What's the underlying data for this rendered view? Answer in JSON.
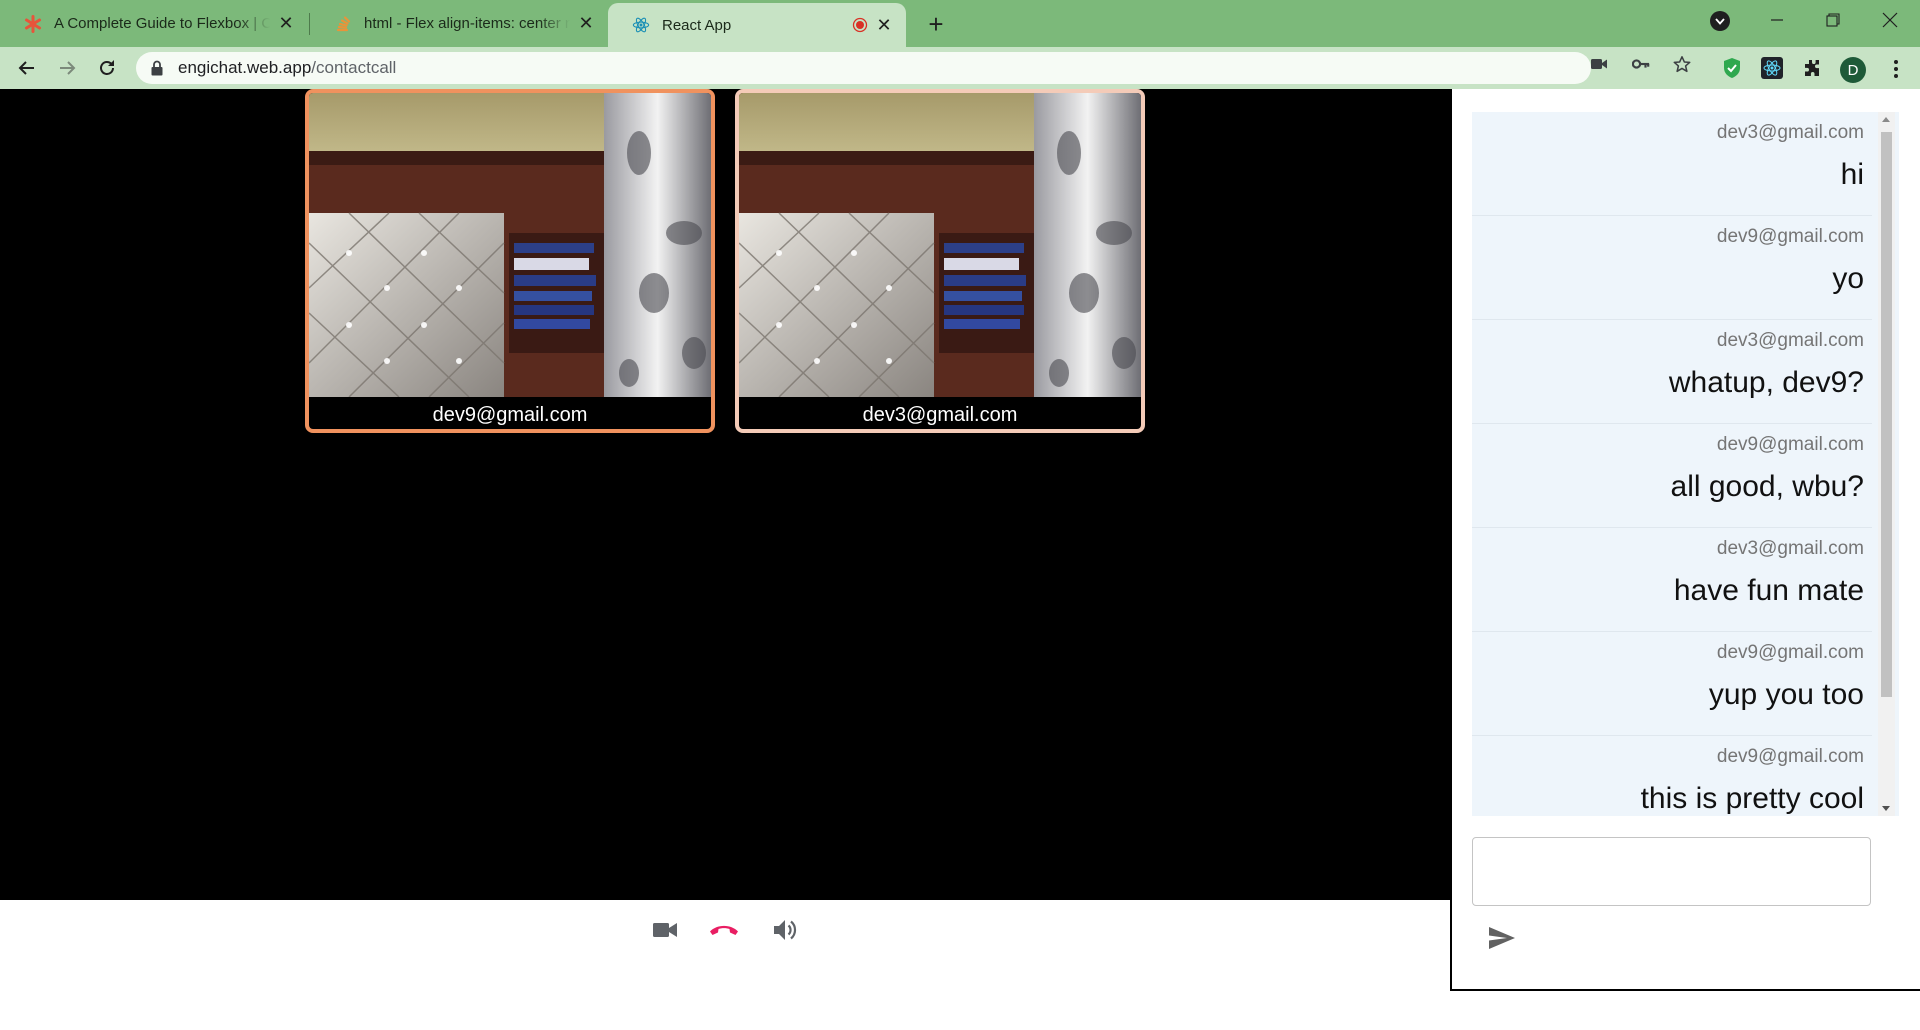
{
  "browser": {
    "tabs": [
      {
        "title": "A Complete Guide to Flexbox | CSS-Tricks",
        "favicon": "asterisk-icon",
        "active": false
      },
      {
        "title": "html - Flex align-items: center not working",
        "favicon": "stackoverflow-icon",
        "active": false
      },
      {
        "title": "React App",
        "favicon": "react-icon",
        "active": true,
        "recording": true
      }
    ],
    "url_host": "engichat.web.app",
    "url_path": "/contactcall",
    "profile_initial": "D",
    "accent_color": "#7cb97a"
  },
  "call": {
    "participants": [
      {
        "label": "dev9@gmail.com",
        "border_color": "#f0925e"
      },
      {
        "label": "dev3@gmail.com",
        "border_color": "#f4cbb8"
      }
    ],
    "controls": {
      "video_icon": "videocam-icon",
      "hangup_icon": "call-end-icon",
      "hangup_color": "#e91e63",
      "audio_icon": "volume-up-icon"
    }
  },
  "chat": {
    "messages": [
      {
        "sender": "dev3@gmail.com",
        "text": "hi"
      },
      {
        "sender": "dev9@gmail.com",
        "text": "yo"
      },
      {
        "sender": "dev3@gmail.com",
        "text": "whatup, dev9?"
      },
      {
        "sender": "dev9@gmail.com",
        "text": "all good, wbu?"
      },
      {
        "sender": "dev3@gmail.com",
        "text": "have fun mate"
      },
      {
        "sender": "dev9@gmail.com",
        "text": "yup you too"
      },
      {
        "sender": "dev9@gmail.com",
        "text": "this is pretty cool"
      }
    ],
    "input_value": "",
    "send_icon": "send-icon",
    "bubble_color": "#eef5fb"
  }
}
